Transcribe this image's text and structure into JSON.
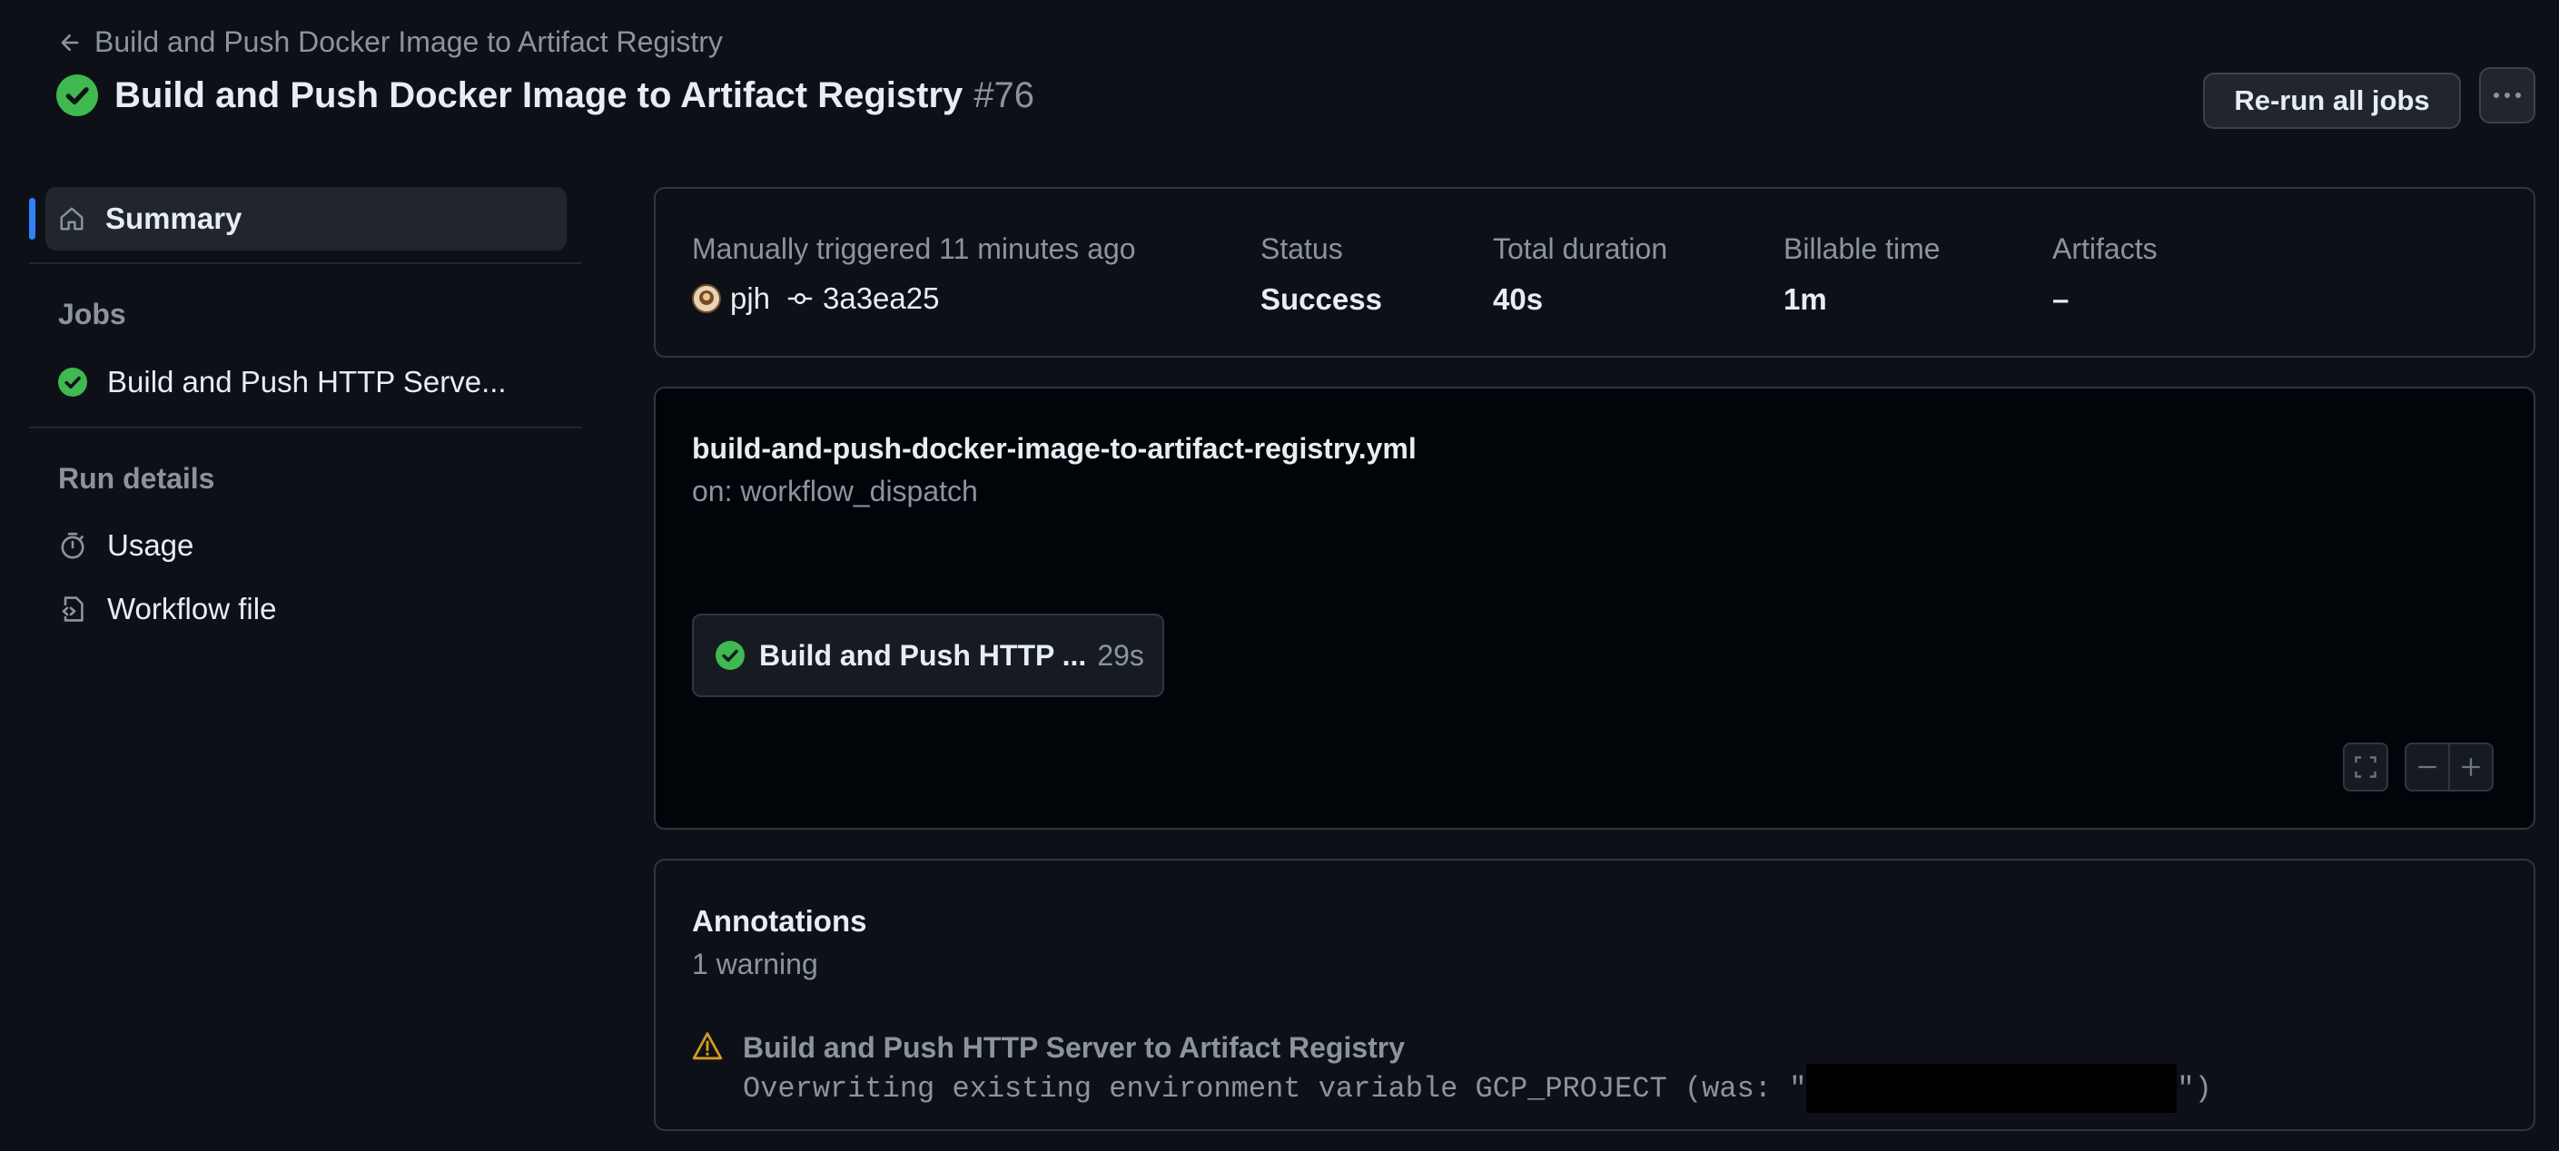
{
  "header": {
    "back_link": "Build and Push Docker Image to Artifact Registry",
    "title": "Build and Push Docker Image to Artifact Registry",
    "run_number": "#76",
    "rerun_button": "Re-run all jobs"
  },
  "sidebar": {
    "summary_label": "Summary",
    "jobs_heading": "Jobs",
    "jobs": [
      {
        "label": "Build and Push HTTP Serve..."
      }
    ],
    "run_details_heading": "Run details",
    "run_details": [
      {
        "label": "Usage",
        "icon": "stopwatch-icon"
      },
      {
        "label": "Workflow file",
        "icon": "file-code-icon"
      }
    ]
  },
  "summary": {
    "trigger_text": "Manually triggered 11 minutes ago",
    "actor": "pjh",
    "commit": "3a3ea25",
    "status_label": "Status",
    "status_value": "Success",
    "duration_label": "Total duration",
    "duration_value": "40s",
    "billable_label": "Billable time",
    "billable_value": "1m",
    "artifacts_label": "Artifacts",
    "artifacts_value": "–"
  },
  "workflow": {
    "file_name": "build-and-push-docker-image-to-artifact-registry.yml",
    "trigger": "on: workflow_dispatch",
    "job_name": "Build and Push HTTP ...",
    "job_duration": "29s"
  },
  "annotations": {
    "heading": "Annotations",
    "count_text": "1 warning",
    "items": [
      {
        "title": "Build and Push HTTP Server to Artifact Registry",
        "message_prefix": "Overwriting existing environment variable GCP_PROJECT (was: \"",
        "message_suffix": "\")"
      }
    ]
  },
  "colors": {
    "success": "#3fb950",
    "warning": "#d29922",
    "accent": "#2f81f7",
    "background": "#0d1117"
  }
}
